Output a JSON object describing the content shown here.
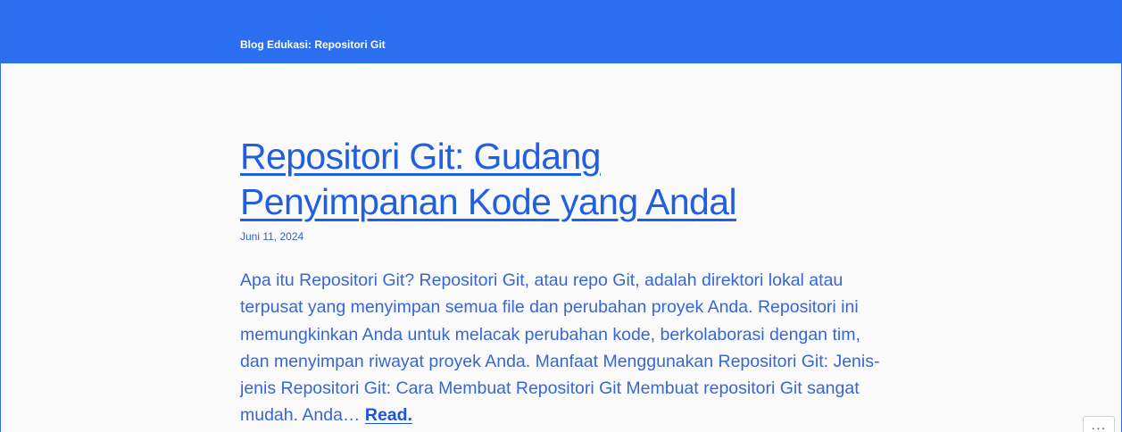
{
  "header": {
    "site_title": "Blog Edukasi: Repositori Git"
  },
  "post": {
    "title": "Repositori Git: Gudang Penyimpanan Kode yang Andal",
    "date": "Juni 11, 2024",
    "excerpt": "Apa itu Repositori Git? Repositori Git, atau repo Git, adalah direktori lokal atau terpusat yang menyimpan semua file dan perubahan proyek Anda. Repositori ini memungkinkan Anda untuk melacak perubahan kode, berkolaborasi dengan tim, dan menyimpan riwayat proyek Anda. Manfaat Menggunakan Repositori Git: Jenis-jenis Repositori Git: Cara Membuat Repositori Git Membuat repositori Git sangat mudah. Anda…",
    "read_more": "Read."
  },
  "widget": {
    "more_icon": "ellipsis-icon",
    "more_glyph": "···"
  },
  "colors": {
    "header_bg": "#2c6ef0",
    "page_bg": "#fafafa",
    "link": "#1f5fe0",
    "text": "#3767d3"
  }
}
